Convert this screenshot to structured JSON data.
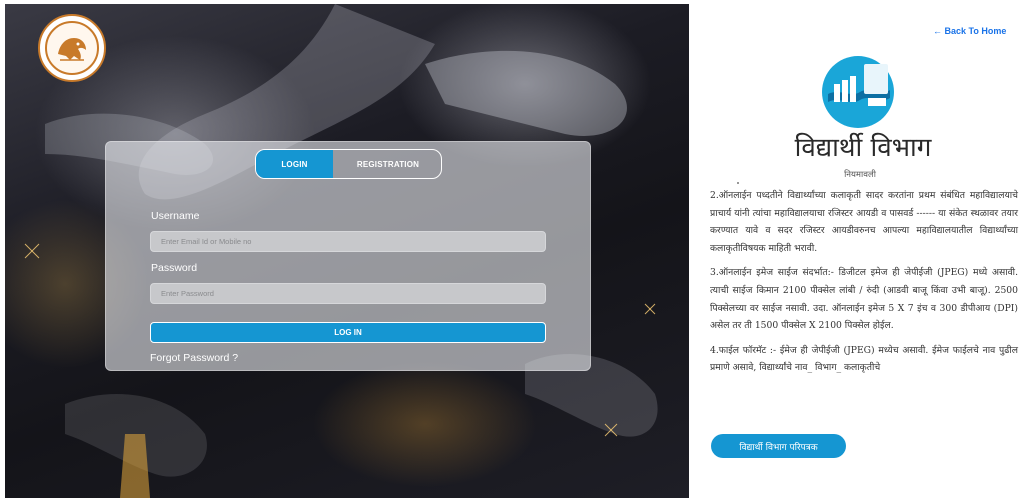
{
  "login": {
    "tabs": [
      {
        "label": "LOGIN",
        "active": true
      },
      {
        "label": "REGISTRATION",
        "active": false
      }
    ],
    "username_label": "Username",
    "username_placeholder": "Enter Email Id or Mobile no",
    "password_label": "Password",
    "password_placeholder": "Enter Password",
    "login_button": "LOG IN",
    "forgot_password": "Forgot Password ?"
  },
  "info": {
    "back_link": "← Back To Home",
    "department_title": "विद्यार्थी विभाग",
    "rules_title": "नियमावली",
    "rules": [
      "2.ऑनलाईन पध्दतीने विद्यार्थ्यांच्या कलाकृती सादर करतांना प्रथम संबंधित महाविद्यालयाचे प्राचार्य यांनी त्यांचा महाविद्यालयाचा रजिस्टर आयडी व पासवर्ड ------ या संकेत स्थळावर तयार करण्यात यावे व सदर रजिस्टर आयडीवरुनच आपल्या महाविद्यालयातील विद्यार्थ्यांच्या कलाकृतीविषयक माहिती भरावी.",
      "3.ऑनलाईन इमेज साईज संदर्भात:- डिजीटल इमेज ही जेपीईजी (JPEG) मध्ये असावी. त्याची साईज किमान 2100 पीक्सेल लांबी / रुंदी (आडवी बाजू किंवा उभी बाजू). 2500 पिक्सेलच्या वर साईज नसावी. उदा. ऑनलाईन इमेज 5 X 7 इंच व 300 डीपीआय (DPI) असेल तर ती 1500 पीक्सेल X 2100 पिक्सेल होईल.",
      "4.फाईल फॉरमॅट :- ईमेज ही जेपीईजी (JPEG) मध्येच असावी. ईमेज फाईलचे नाव पुढील प्रमाणे असावे, विद्यार्थ्यांचे नाव_ विभाग_ कलाकृतीचे"
    ],
    "circular_button": "विद्यार्थी विभाग परिपत्रक"
  },
  "colors": {
    "accent": "#1596d2",
    "link": "#1a73e8"
  }
}
